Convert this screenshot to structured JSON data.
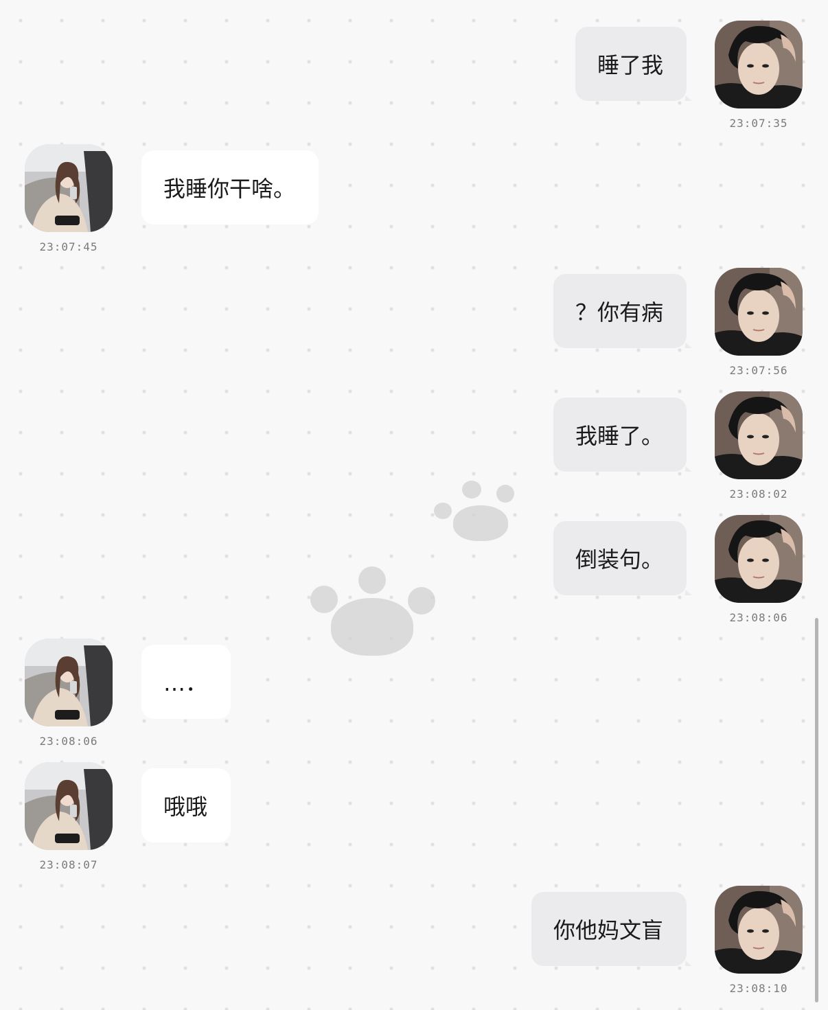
{
  "messages": [
    {
      "side": "right",
      "sender": "boy",
      "text": "睡了我",
      "time": "23:07:35"
    },
    {
      "side": "left",
      "sender": "girl",
      "text": "我睡你干啥。",
      "time": "23:07:45"
    },
    {
      "side": "right",
      "sender": "boy",
      "text": "？你有病",
      "time": "23:07:56"
    },
    {
      "side": "right",
      "sender": "boy",
      "text": "我睡了。",
      "time": "23:08:02"
    },
    {
      "side": "right",
      "sender": "boy",
      "text": "倒装句。",
      "time": "23:08:06"
    },
    {
      "side": "left",
      "sender": "girl",
      "text": "…．",
      "time": "23:08:06"
    },
    {
      "side": "left",
      "sender": "girl",
      "text": "哦哦",
      "time": "23:08:07"
    },
    {
      "side": "right",
      "sender": "boy",
      "text": "你他妈文盲",
      "time": "23:08:10"
    }
  ],
  "colors": {
    "background": "#f8f8f8",
    "outgoing_bubble": "#ebebee",
    "incoming_bubble": "#ffffff",
    "timestamp": "#7a7a7a"
  },
  "icons": {
    "background_decoration": "paw-print-icon",
    "outgoing_avatar": "boy-avatar",
    "incoming_avatar": "girl-avatar"
  }
}
